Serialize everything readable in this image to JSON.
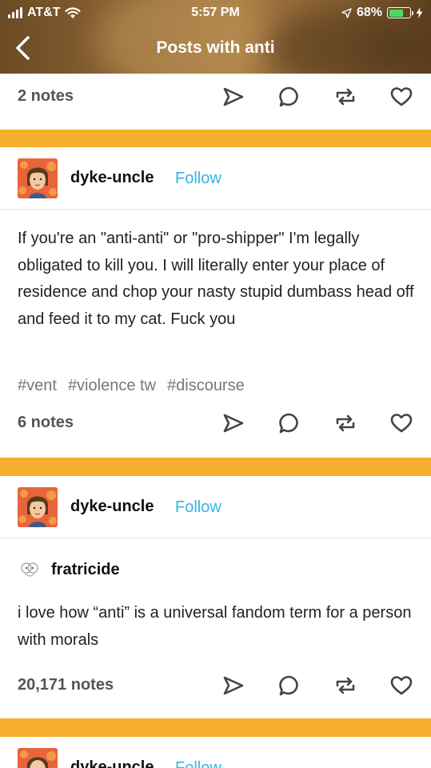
{
  "status": {
    "carrier": "AT&T",
    "time": "5:57 PM",
    "battery": "68%",
    "battery_level": 0.68
  },
  "nav": {
    "title": "Posts with anti"
  },
  "colors": {
    "accent": "#f5af2c",
    "follow": "#36b3e8",
    "battery": "#4cd964"
  },
  "post0": {
    "notes": "2 notes"
  },
  "post1": {
    "author": "dyke-uncle",
    "follow": "Follow",
    "body": "If you're an \"anti-anti\" or \"pro-shipper\" I'm legally obligated to kill you. I will literally enter your place of residence and chop your nasty stupid dumbass head off and feed it to my cat. Fuck you",
    "tags": [
      "#vent",
      "#violence tw",
      "#discourse"
    ],
    "notes": "6 notes"
  },
  "post2": {
    "author": "dyke-uncle",
    "follow": "Follow",
    "reblog_author": "fratricide",
    "body": "i love how “anti” is a universal fandom term for a person with morals",
    "notes": "20,171 notes"
  },
  "post3": {
    "author": "dyke-uncle",
    "follow": "Follow"
  },
  "icons": {
    "share": "paper-plane-icon",
    "reply": "speech-bubble-icon",
    "reblog": "reblog-arrows-icon",
    "like": "heart-icon"
  }
}
